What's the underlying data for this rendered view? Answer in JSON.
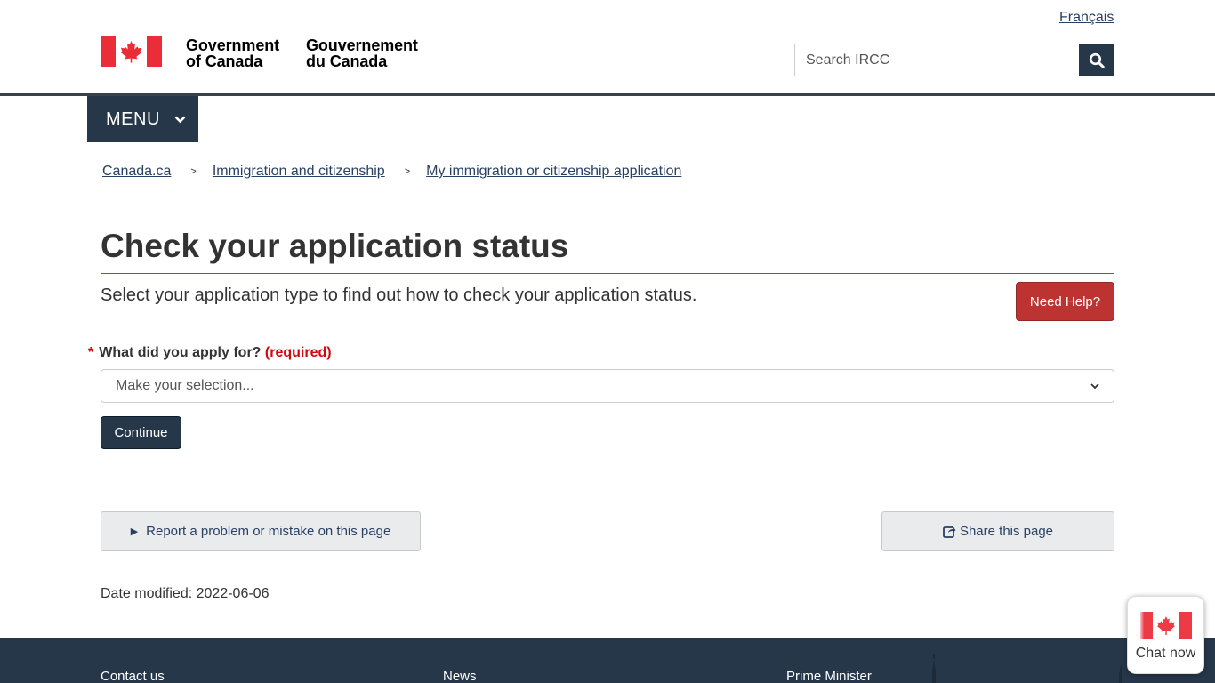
{
  "header": {
    "language_link": "Français",
    "brand_en_line1": "Government",
    "brand_en_line2": "of Canada",
    "brand_fr_line1": "Gouvernement",
    "brand_fr_line2": "du Canada",
    "search_placeholder": "Search IRCC",
    "search_icon": "search-icon"
  },
  "menu": {
    "label": "MENU",
    "icon": "chevron-down-icon"
  },
  "breadcrumb": {
    "sep": ">",
    "items": [
      "Canada.ca",
      "Immigration and citizenship",
      "My immigration or citizenship application"
    ]
  },
  "main": {
    "title": "Check your application status",
    "intro": "Select your application type to find out how to check your application status.",
    "help_button": "Need Help?",
    "form": {
      "required_marker": "*",
      "label": "What did you apply for?",
      "required_text": "(required)",
      "select_value": "Make your selection...",
      "continue_button": "Continue"
    },
    "report_button": "Report a problem or mistake on this page",
    "share_button": "Share this page",
    "date_label": "Date modified:",
    "date_value": "2022-06-06"
  },
  "footer": {
    "links": [
      "Contact us",
      "News",
      "Prime Minister"
    ]
  },
  "chat": {
    "label": "Chat now"
  },
  "colors": {
    "navy": "#26374a",
    "link": "#284162",
    "accent_red": "#af3c43",
    "help_red": "#bc3331",
    "required_red": "#d3080c",
    "flag_red": "#eb2d37"
  }
}
